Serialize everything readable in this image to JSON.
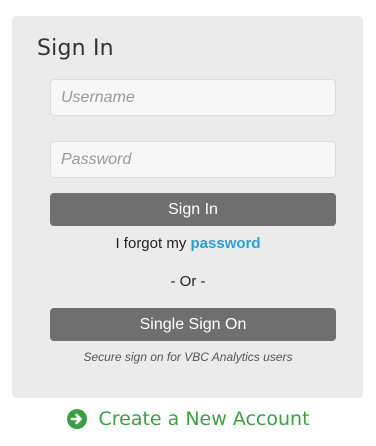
{
  "signin": {
    "title": "Sign In",
    "username_placeholder": "Username",
    "password_placeholder": "Password",
    "signin_button": "Sign In",
    "forgot_prefix": "I forgot my ",
    "forgot_link": "password",
    "or_separator": "- Or -",
    "sso_button": "Single Sign On",
    "secure_note": "Secure sign on for VBC Analytics users"
  },
  "footer": {
    "create_account": "Create a New Account",
    "create_icon": "arrow-circle-right-icon"
  },
  "colors": {
    "card_bg": "#ebebeb",
    "button_bg": "#6f6f6f",
    "link_blue": "#2a9fd8",
    "create_green": "#3aa043"
  }
}
